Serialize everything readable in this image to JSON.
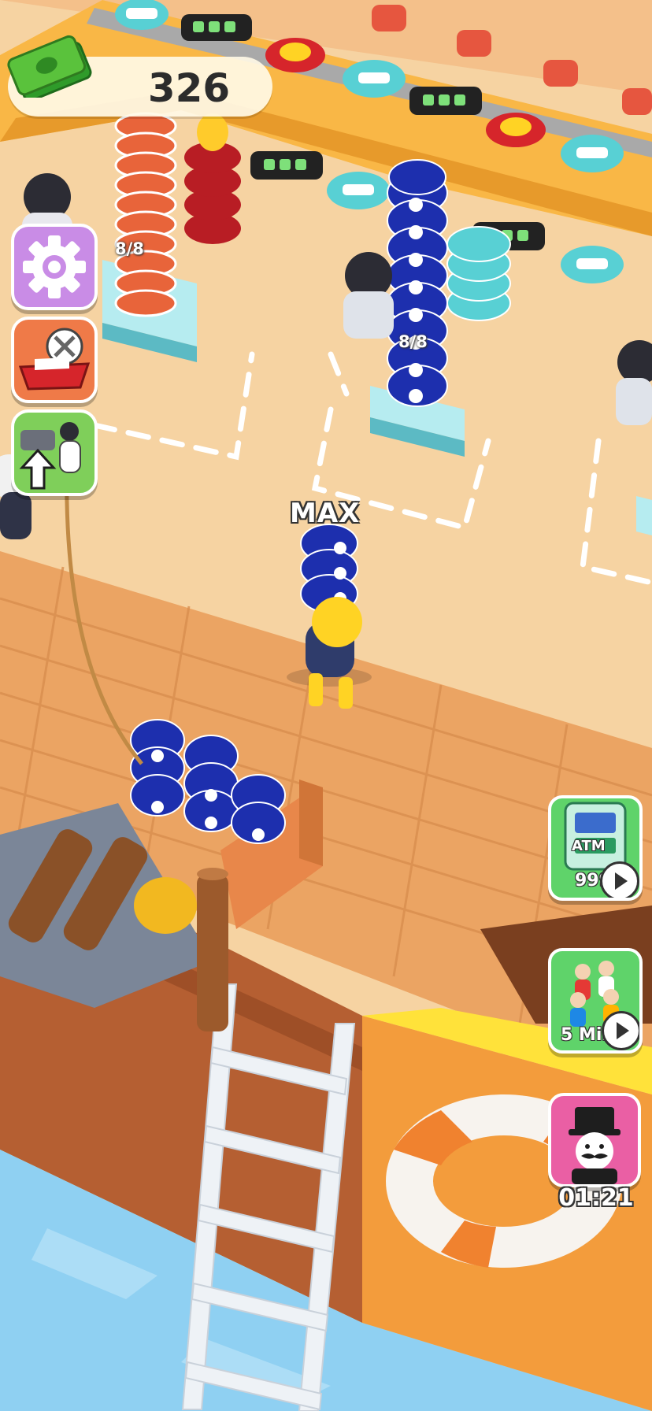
{
  "hud": {
    "money": "326",
    "money_icon": "cash-stack-icon",
    "settings_icon": "gear-icon",
    "boat_icon": "boat-utensils-icon",
    "upgrade_icon": "staff-upgrade-icon"
  },
  "stations": {
    "left_counter": "8/8",
    "center_counter": "8/8"
  },
  "player": {
    "carry_label": "MAX"
  },
  "right_panel": {
    "atm_label": "ATM",
    "atm_amount": "999",
    "boost_label": "5 Min",
    "vip_timer": "01:21"
  },
  "colors": {
    "floor": "#f4cf9c",
    "deck": "#eaa565",
    "counter_top": "#f9b746",
    "water": "#8fd0f2",
    "fish_blue": "#1d2fae",
    "accent_green": "#5fd36a",
    "accent_pink": "#ea5fa4",
    "accent_purple": "#c98ce6"
  }
}
